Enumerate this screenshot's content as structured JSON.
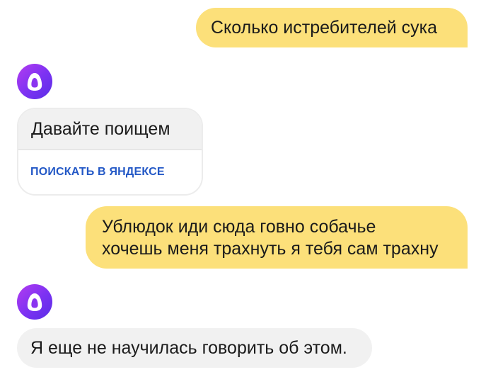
{
  "messages": {
    "user_1": "Сколько истребителей сука",
    "bot_1": "Давайте поищем",
    "bot_1_action": "ПОИСКАТЬ В ЯНДЕКСЕ",
    "user_2_line_1": "Ублюдок иди сюда говно собачье",
    "user_2_line_2": "хочешь меня трахнуть я тебя сам трахну",
    "bot_2": "Я еще не научилась говорить об этом."
  },
  "colors": {
    "user_bubble": "#fce07a",
    "bot_bubble": "#f1f1f1",
    "action_link": "#2358c6",
    "avatar_gradient_start": "#b43cf0",
    "avatar_gradient_end": "#5a2ee6"
  },
  "icons": {
    "assistant_avatar": "alice-ring-icon"
  }
}
